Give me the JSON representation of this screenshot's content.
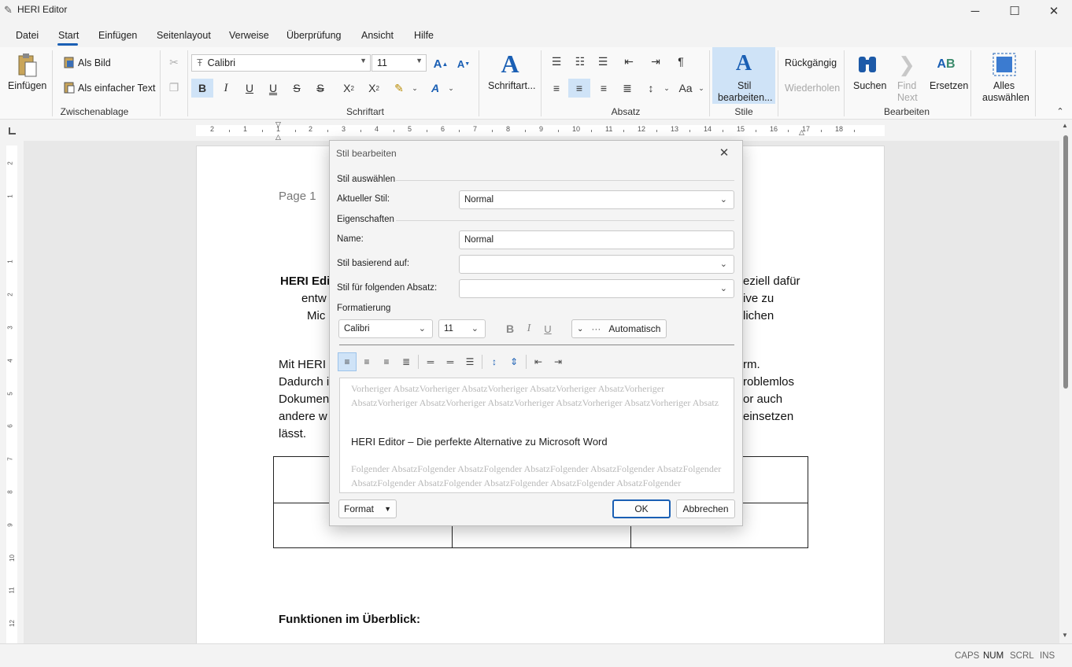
{
  "window": {
    "title": "HERI Editor"
  },
  "menu": [
    "Datei",
    "Start",
    "Einfügen",
    "Seitenlayout",
    "Verweise",
    "Überprüfung",
    "Ansicht",
    "Hilfe"
  ],
  "ribbon": {
    "clipboard": {
      "paste": "Einfügen",
      "as_image": "Als Bild",
      "as_text": "Als einfacher Text",
      "label": "Zwischenablage"
    },
    "font": {
      "family": "Calibri",
      "size": "11",
      "dialog_btn": "Schriftart...",
      "label": "Schriftart"
    },
    "paragraph": {
      "label": "Absatz"
    },
    "styles": {
      "edit_line1": "Stil",
      "edit_line2": "bearbeiten...",
      "label": "Stile"
    },
    "undo": "Rückgängig",
    "redo": "Wiederholen",
    "edit": {
      "search": "Suchen",
      "find_next_1": "Find",
      "find_next_2": "Next",
      "replace": "Ersetzen",
      "select_all_1": "Alles",
      "select_all_2": "auswählen",
      "label": "Bearbeiten"
    }
  },
  "ruler": {
    "h_ticks": [
      "2",
      "1",
      "1",
      "2",
      "3",
      "4",
      "5",
      "6",
      "7",
      "8",
      "9",
      "10",
      "11",
      "12",
      "13",
      "14",
      "15",
      "16",
      "17",
      "18"
    ],
    "v_ticks": [
      "2",
      "1",
      "",
      "1",
      "2",
      "3",
      "4",
      "5",
      "6",
      "7",
      "8",
      "9",
      "10",
      "11",
      "12"
    ]
  },
  "document": {
    "header": "Page 1",
    "p1": [
      {
        "l": "HERI Edit",
        "r": "eziell dafür"
      },
      {
        "l": "entw",
        "r": "ive zu"
      },
      {
        "l": "Mic",
        "r": "lichen"
      }
    ],
    "p2": [
      {
        "l": "Mit HERI E",
        "r": "rm."
      },
      {
        "l": "Dadurch i",
        "r": "roblemlos"
      },
      {
        "l": "Dokumen",
        "r": "or auch"
      },
      {
        "l": "andere w",
        "r": "einsetzen"
      },
      {
        "l": "lässt.",
        "r": ""
      }
    ],
    "section_heading": "Funktionen im Überblick:"
  },
  "dialog": {
    "title": "Stil bearbeiten",
    "select_section": "Stil auswählen",
    "current_style_label": "Aktueller Stil:",
    "current_style_value": "Normal",
    "props_section": "Eigenschaften",
    "name_label": "Name:",
    "name_value": "Normal",
    "based_on_label": "Stil basierend auf:",
    "based_on_value": "",
    "next_label": "Stil für folgenden Absatz:",
    "next_value": "",
    "format_section": "Formatierung",
    "font": "Calibri",
    "size": "11",
    "color": "Automatisch",
    "preview_prev": "Vorheriger AbsatzVorheriger AbsatzVorheriger AbsatzVorheriger AbsatzVorheriger AbsatzVorheriger AbsatzVorheriger AbsatzVorheriger AbsatzVorheriger AbsatzVorheriger Absatz",
    "preview_text": "HERI Editor – Die perfekte Alternative zu Microsoft Word",
    "preview_next": "Folgender AbsatzFolgender AbsatzFolgender AbsatzFolgender AbsatzFolgender AbsatzFolgender AbsatzFolgender AbsatzFolgender AbsatzFolgender AbsatzFolgender AbsatzFolgender AbsatzFolgender AbsatzFolgender Absatz",
    "format_btn": "Format",
    "ok": "OK",
    "cancel": "Abbrechen"
  },
  "status": [
    "CAPS",
    "NUM",
    "SCRL",
    "INS"
  ],
  "colors": {
    "accent": "#1a5fb4",
    "selected_bg": "#cfe3f7"
  }
}
